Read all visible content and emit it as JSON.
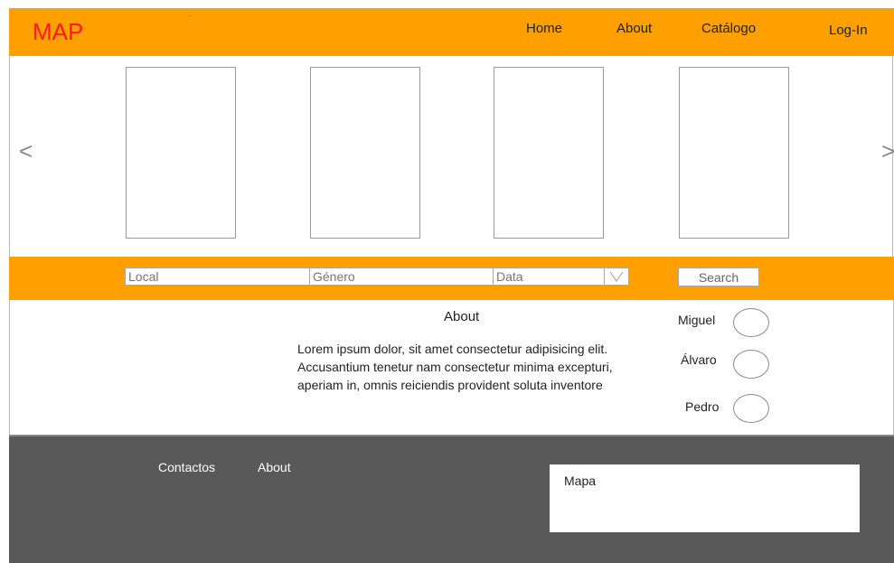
{
  "navbar": {
    "brand": "MAP",
    "links": [
      "Home",
      "About",
      "Catálogo",
      "Log-In"
    ]
  },
  "carousel": {
    "prev_icon": "chevron-left-icon",
    "next_icon": "chevron-right-icon",
    "prev_glyph": "<",
    "next_glyph": ">"
  },
  "search": {
    "local_placeholder": "Local",
    "genero_placeholder": "Género",
    "data_placeholder": "Data",
    "button_label": "Search"
  },
  "about": {
    "title": "About",
    "text": "Lorem ipsum dolor, sit amet consectetur adipisicing elit. Accusantium tenetur nam consectetur minima excepturi, aperiam in, omnis reiciendis provident soluta inventore",
    "members": [
      "Miguel",
      "Álvaro",
      "Pedro"
    ]
  },
  "footer": {
    "links": [
      "Contactos",
      "About"
    ],
    "map_label": "Mapa"
  },
  "colors": {
    "accent": "#ffa000",
    "brand": "#ff1a1a",
    "footer": "#595959"
  }
}
